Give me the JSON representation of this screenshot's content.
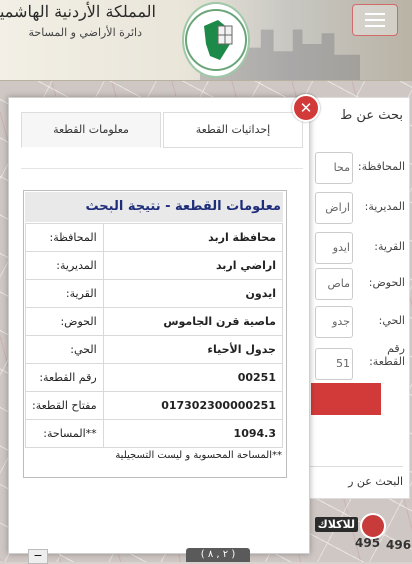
{
  "header": {
    "kingdom": "المملكة الأردنية الهاشمية",
    "department": "دائرة الأراضي و المساحة"
  },
  "modal": {
    "tabs": {
      "coords": "إحداثيات القطعة",
      "info": "معلومات القطعة"
    },
    "title": "معلومات القطعة - نتيجة البحث",
    "rows": [
      {
        "label": "المحافظة:",
        "value": "محافظة اربد"
      },
      {
        "label": "المديرية:",
        "value": "اراضي اربد"
      },
      {
        "label": "القرية:",
        "value": "ايدون"
      },
      {
        "label": "الحوض:",
        "value": "ماصية قرن الجاموس"
      },
      {
        "label": "الحي:",
        "value": "جدول الأحياء"
      },
      {
        "label": "رقم القطعة:",
        "value": "00251"
      },
      {
        "label": "مفتاح القطعة:",
        "value": "017302300000251"
      },
      {
        "label": "**المساحة:",
        "value": "1094.3"
      }
    ],
    "note": "**المساحة المحسوبة و ليست التسجيلية",
    "close": "✕"
  },
  "side_panel": {
    "title": "بحث عن ط",
    "rows": [
      {
        "label": "المحافظة:",
        "value": "محا"
      },
      {
        "label": "المديرية:",
        "value": "اراض"
      },
      {
        "label": "القرية:",
        "value": "ايدو"
      },
      {
        "label": "الحوض:",
        "value": "ماص"
      },
      {
        "label": "الحي:",
        "value": "جدو"
      },
      {
        "label": "رقم القطعة:",
        "value": "51"
      }
    ],
    "footer": "البحث عن ر"
  },
  "map": {
    "numbers": [
      "495",
      "496"
    ],
    "coord_readout": "( ٢ , ٨ )",
    "brand": "للاكلاك"
  }
}
